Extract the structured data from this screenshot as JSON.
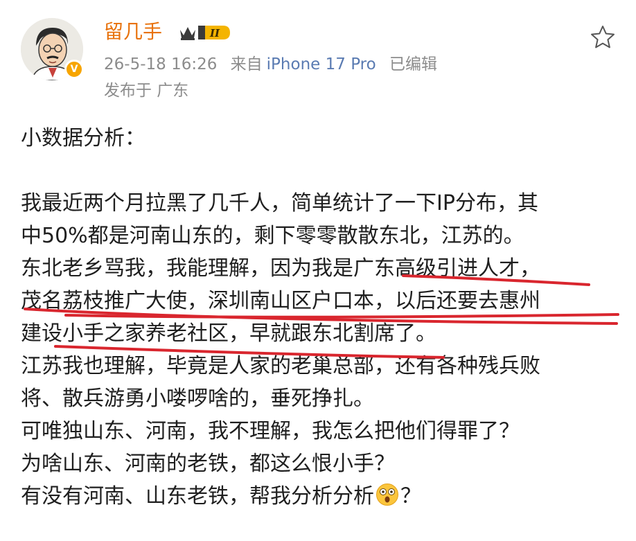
{
  "header": {
    "username": "留几手",
    "rank_level": "II",
    "verified_mark": "V",
    "timestamp": "26-5-18 16:26",
    "source": "来自",
    "device": "iPhone 17 Pro",
    "edited": "已编辑",
    "location": "发布于 广东"
  },
  "post": {
    "lines": [
      "小数据分析：",
      "我最近两个月拉黑了几千人，简单统计了一下IP分布，其",
      "中50%都是河南山东的，剩下零零散散东北，江苏的。",
      "东北老乡骂我，我能理解，因为我是广东高级引进人才，",
      "茂名荔枝推广大使，深圳南山区户口本，以后还要去惠州",
      "建设小手之家养老社区，早就跟东北割席了。",
      "江苏我也理解，毕竟是人家的老巢总部，还有各种残兵败",
      "将、散兵游勇小喽啰啥的，垂死挣扎。",
      "可唯独山东、河南，我不理解，我怎么把他们得罪了？",
      "为啥山东、河南的老铁，都这么恨小手？",
      "有没有河南、山东老铁，帮我分析分析",
      "？"
    ]
  },
  "icons": {
    "favorite": "star-outline-icon",
    "emoji": "dizzy-face-emoji-icon",
    "verified": "verified-badge-icon"
  },
  "colors": {
    "username": "#e8720c",
    "meta": "#8c8c8c",
    "device": "#5a7bb2",
    "annotation": "#d9262e",
    "badge": "#f7a500"
  }
}
